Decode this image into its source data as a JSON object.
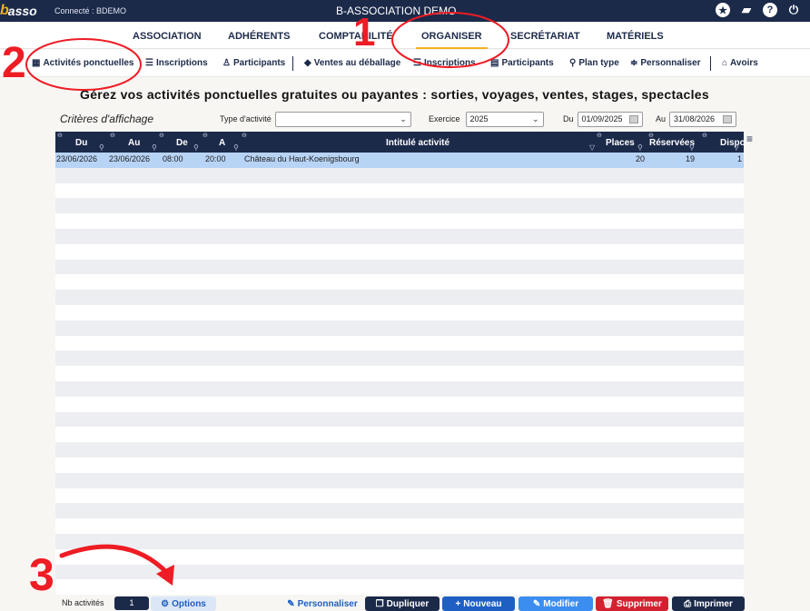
{
  "topbar": {
    "logo_b": "b",
    "logo_text": "asso",
    "connected": "Connecté : BDEMO",
    "title": "B-ASSOCIATION DEMO",
    "icons": [
      "star-icon",
      "book-icon",
      "help-icon",
      "power-icon"
    ]
  },
  "main_menu": {
    "items": [
      "ASSOCIATION",
      "ADHÉRENTS",
      "COMPTABILITÉ",
      "ORGANISER",
      "SECRÉTARIAT",
      "MATÉRIELS"
    ],
    "active": "ORGANISER"
  },
  "sub_menu": {
    "items": [
      "Activités ponctuelles",
      "Inscriptions",
      "Participants",
      "Ventes au déballage",
      "Inscriptions",
      "Participants",
      "Plan type",
      "Personnaliser",
      "Avoirs"
    ]
  },
  "heading": "Gérez vos activités ponctuelles gratuites ou payantes : sorties, voyages, ventes, stages, spectacles",
  "criteria": {
    "title": "Critères d'affichage",
    "type_label": "Type d'activité",
    "type_value": "",
    "exercice_label": "Exercice",
    "exercice_value": "2025",
    "du_label": "Du",
    "du_value": "01/09/2025",
    "au_label": "Au",
    "au_value": "31/08/2026"
  },
  "table": {
    "columns": [
      "Du",
      "Au",
      "De",
      "A",
      "Intitulé activité",
      "Places",
      "Réservées",
      "Dispo"
    ],
    "rows": [
      {
        "du": "23/06/2026",
        "au": "23/06/2026",
        "de": "08:00",
        "a": "20:00",
        "intitule": "Château du Haut-Koenigsbourg",
        "places": "20",
        "reservees": "19",
        "dispo": "1"
      }
    ]
  },
  "bottom": {
    "nb_label": "Nb activités",
    "nb_value": "1",
    "options": "Options",
    "personnaliser": "Personnaliser",
    "dupliquer": "Dupliquer",
    "nouveau": "Nouveau",
    "modifier": "Modifier",
    "supprimer": "Supprimer",
    "imprimer": "Imprimer"
  },
  "annotations": {
    "one": "1",
    "two": "2",
    "three": "3",
    "color": "#ee1c24"
  }
}
